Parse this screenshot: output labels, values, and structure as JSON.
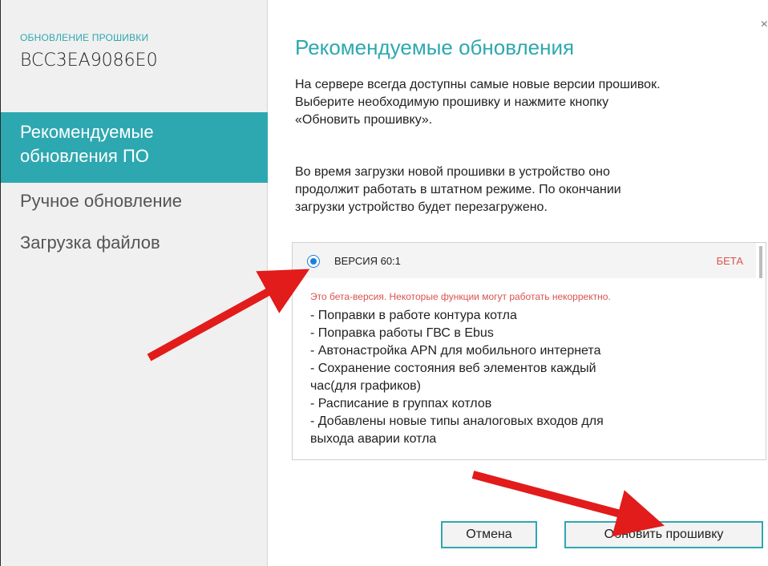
{
  "sidebar": {
    "header": "ОБНОВЛЕНИЕ ПРОШИВКИ",
    "device_id": "BCC3EA9086E0",
    "items": [
      {
        "label_line1": "Рекомендуемые",
        "label_line2": "обновления ПО"
      },
      {
        "label": "Ручное обновление"
      },
      {
        "label": "Загрузка файлов"
      }
    ]
  },
  "main": {
    "close": "×",
    "title": "Рекомендуемые обновления",
    "desc1": [
      "На сервере всегда доступны самые новые версии прошивок.",
      "Выберите необходимую прошивку и нажмите кнопку",
      "«Обновить прошивку»."
    ],
    "desc2": [
      "Во время загрузки новой прошивки в устройство оно",
      "продолжит работать в штатном режиме. По окончании",
      "загрузки устройство будет перезагружено."
    ],
    "version": {
      "label": "ВЕРСИЯ 60:1",
      "badge": "БЕТА",
      "warning": "Это бета-версия. Некоторые функции могут работать некорректно.",
      "notes": [
        "- Поправки в работе контура котла",
        "- Поправка работы ГВС в Ebus",
        "- Автонастройка APN для мобильного интернета",
        "- Сохранение состояния веб элементов каждый",
        "час(для графиков)",
        "- Расписание в группах котлов",
        "- Добавлены новые типы аналоговых входов для",
        "выхода аварии котла"
      ]
    },
    "buttons": {
      "cancel": "Отмена",
      "update": "Обновить прошивку"
    }
  },
  "colors": {
    "accent": "#2ea8b0",
    "warning": "#d9534f",
    "arrow": "#e21b1b"
  }
}
